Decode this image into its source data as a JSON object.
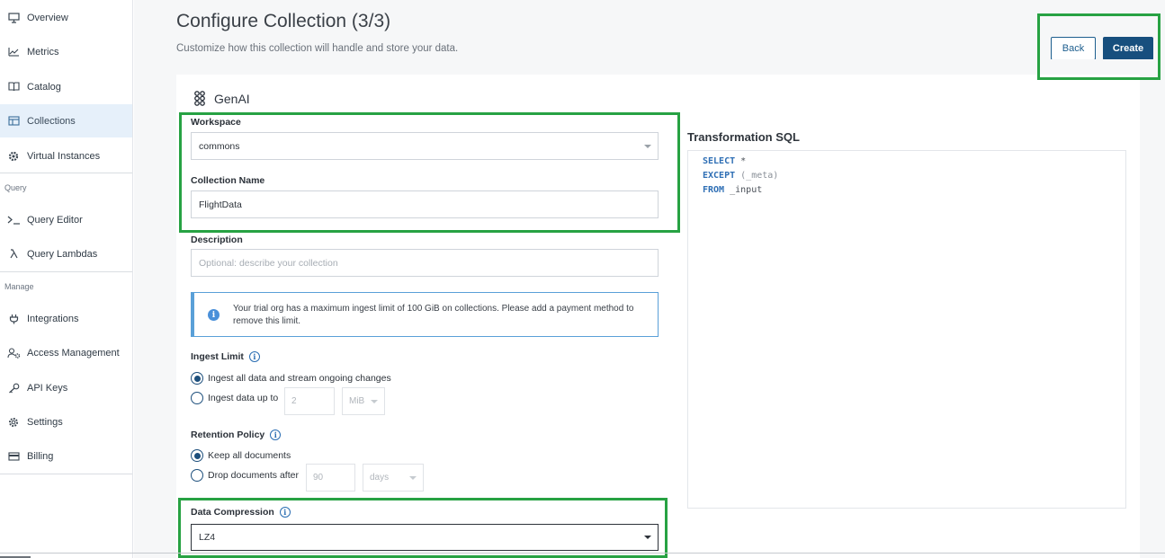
{
  "sidebar": {
    "items": [
      {
        "label": "Overview",
        "icon": "monitor-icon"
      },
      {
        "label": "Metrics",
        "icon": "chart-icon"
      },
      {
        "label": "Catalog",
        "icon": "book-icon"
      },
      {
        "label": "Collections",
        "icon": "table-icon",
        "active": true
      },
      {
        "label": "Virtual Instances",
        "icon": "gear-chip-icon"
      },
      {
        "label": "Query Editor",
        "icon": "terminal-icon"
      },
      {
        "label": "Query Lambdas",
        "icon": "lambda-icon"
      },
      {
        "label": "Integrations",
        "icon": "plug-icon"
      },
      {
        "label": "Access Management",
        "icon": "users-gear-icon"
      },
      {
        "label": "API Keys",
        "icon": "key-icon"
      },
      {
        "label": "Settings",
        "icon": "gear-icon"
      },
      {
        "label": "Billing",
        "icon": "credit-card-icon"
      }
    ],
    "sections": {
      "query": "Query",
      "manage": "Manage"
    }
  },
  "header": {
    "title": "Configure Collection (3/3)",
    "subtitle": "Customize how this collection will handle and store your data.",
    "back_label": "Back",
    "create_label": "Create"
  },
  "source": {
    "name": "GenAI",
    "icon": "genai-icon"
  },
  "form": {
    "workspace": {
      "label": "Workspace",
      "value": "commons"
    },
    "collection_name": {
      "label": "Collection Name",
      "value": "FlightData"
    },
    "description": {
      "label": "Description",
      "placeholder": "Optional: describe your collection"
    },
    "alert": "Your trial org has a maximum ingest limit of 100 GiB on collections. Please add a payment method to remove this limit.",
    "ingest_limit": {
      "label": "Ingest Limit",
      "option_all": "Ingest all data and stream ongoing changes",
      "option_up_to": "Ingest data up to",
      "amount": "2",
      "unit": "MiB",
      "selected": "all"
    },
    "retention": {
      "label": "Retention Policy",
      "option_keep": "Keep all documents",
      "option_drop": "Drop documents after",
      "amount": "90",
      "unit": "days",
      "selected": "keep"
    },
    "compression": {
      "label": "Data Compression",
      "value": "LZ4"
    }
  },
  "sql": {
    "title": "Transformation SQL",
    "line1_kw": "SELECT",
    "line1_rest": " *",
    "line2_kw": "EXCEPT",
    "line2_paren_open": " (",
    "line2_rest": "_meta",
    "line2_paren_close": ")",
    "line3_kw": "FROM",
    "line3_rest": " _input"
  },
  "colors": {
    "accent": "#174f7e",
    "highlight": "#27a243",
    "active_nav": "#e6f0fa",
    "info": "#4a90d9"
  }
}
